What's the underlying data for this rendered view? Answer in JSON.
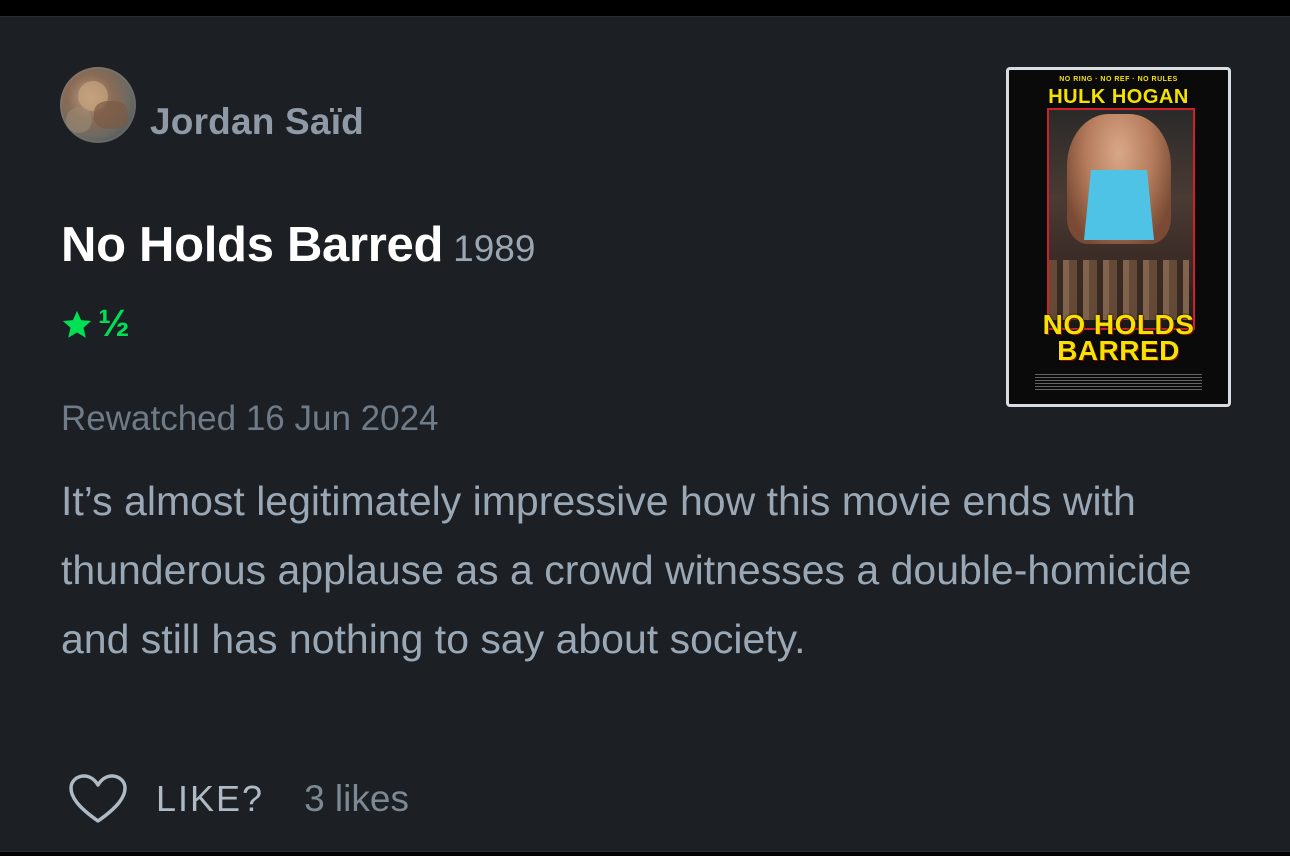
{
  "review": {
    "username": "Jordan Saïd",
    "film_title": "No Holds Barred",
    "film_year": "1989",
    "rating": {
      "stars": 1.5,
      "half_glyph": "½",
      "color": "#00e054"
    },
    "watched_text": "Rewatched 16 Jun 2024",
    "body": "It’s almost legitimately impressive how this movie ends with thunderous applause as a crowd witnesses a double-homicide and still has nothing to say about society.",
    "like_label": "LIKE?",
    "likes_count": "3 likes",
    "icons": {
      "like": "heart-icon",
      "rating": "star-icon"
    }
  },
  "poster": {
    "tagline": "NO RING · NO REF · NO RULES",
    "star_name": "HULK HOGAN",
    "title_line1": "NO HOLDS",
    "title_line2": "BARRED"
  }
}
